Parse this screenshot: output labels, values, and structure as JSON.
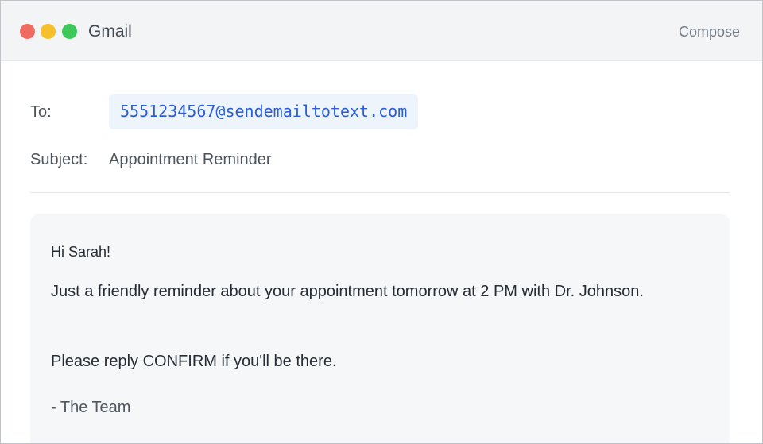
{
  "window": {
    "title": "Gmail",
    "compose_label": "Compose",
    "controls": [
      "close-dot",
      "minimize-dot",
      "zoom-dot"
    ],
    "colors": {
      "close": "#ef6b62",
      "minimize": "#f6bf2c",
      "zoom": "#3fc85a"
    }
  },
  "email": {
    "to_label": "To:",
    "to_value": "5551234567@sendemailtotext.com",
    "subject_label": "Subject:",
    "subject_value": "Appointment Reminder",
    "greeting": "Hi Sarah!",
    "paragraph1": "Just a friendly reminder about your appointment tomorrow at 2 PM with Dr. Johnson.",
    "paragraph2": "Please reply CONFIRM if you'll be there.",
    "signoff": "- The Team"
  },
  "colors": {
    "recipient_text": "#2a5ed6",
    "recipient_background": "#eef4fc",
    "body_background": "#f5f7f9"
  }
}
